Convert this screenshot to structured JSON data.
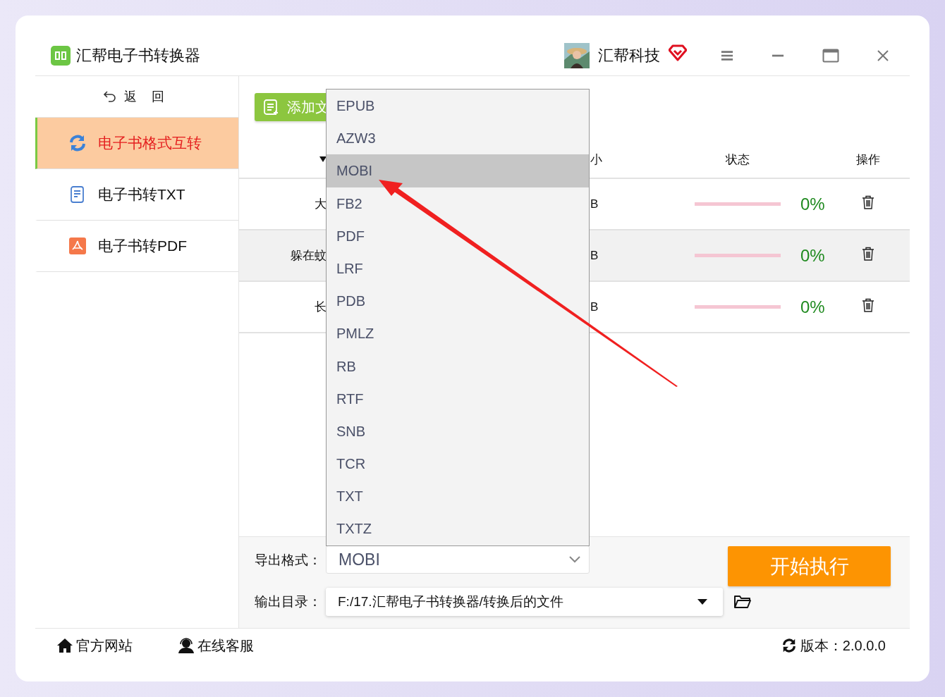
{
  "app": {
    "title": "汇帮电子书转换器",
    "account": "汇帮科技"
  },
  "sidebar": {
    "back": "返 回",
    "items": [
      {
        "label": "电子书格式互转",
        "selected": true,
        "kind": "convert"
      },
      {
        "label": "电子书转TXT",
        "selected": false,
        "kind": "txt"
      },
      {
        "label": "电子书转PDF",
        "selected": false,
        "kind": "pdf"
      }
    ]
  },
  "toolbar": {
    "add_button": "添加文"
  },
  "table": {
    "header": {
      "column_3": "小",
      "status": "状态",
      "actions": "操作"
    },
    "rows": [
      {
        "column_1": "大",
        "column_3": "B",
        "progress": "0%",
        "selected": false
      },
      {
        "column_1": "躲在蚊",
        "column_3": "B",
        "progress": "0%",
        "selected": true
      },
      {
        "column_1": "长",
        "column_3": "B",
        "progress": "0%",
        "selected": false
      }
    ]
  },
  "dropdown": {
    "options": [
      {
        "label": "EPUB",
        "selected": false
      },
      {
        "label": "AZW3",
        "selected": false
      },
      {
        "label": "MOBI",
        "selected": true
      },
      {
        "label": "FB2",
        "selected": false
      },
      {
        "label": "PDF",
        "selected": false
      },
      {
        "label": "LRF",
        "selected": false
      },
      {
        "label": "PDB",
        "selected": false
      },
      {
        "label": "PMLZ",
        "selected": false
      },
      {
        "label": "RB",
        "selected": false
      },
      {
        "label": "RTF",
        "selected": false
      },
      {
        "label": "SNB",
        "selected": false
      },
      {
        "label": "TCR",
        "selected": false
      },
      {
        "label": "TXT",
        "selected": false
      },
      {
        "label": "TXTZ",
        "selected": false
      }
    ]
  },
  "output": {
    "format_label": "导出格式：",
    "format_value": "MOBI",
    "dir_label": "输出目录：",
    "dir_value": "F:/17.汇帮电子书转换器/转换后的文件",
    "start_button": "开始执行"
  },
  "footer": {
    "website": "官方网站",
    "support": "在线客服",
    "version": "版本：2.0.0.0"
  }
}
